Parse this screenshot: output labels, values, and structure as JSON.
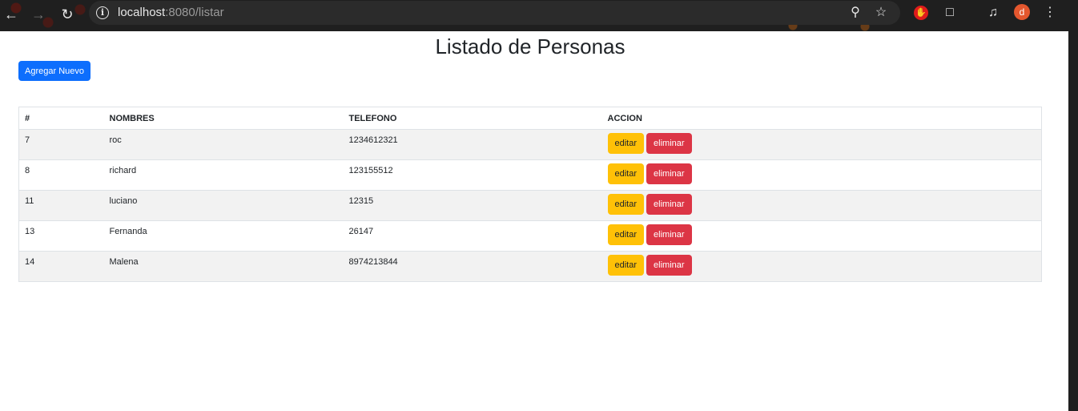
{
  "browser": {
    "url_host": "localhost",
    "url_rest": ":8080/listar",
    "avatar_letter": "d"
  },
  "page": {
    "title": "Listado de Personas",
    "add_button": "Agregar Nuevo"
  },
  "table": {
    "headers": [
      "#",
      "NOMBRES",
      "TELEFONO",
      "ACCION"
    ],
    "rows": [
      {
        "id": "7",
        "name": "roc",
        "phone": "1234612321"
      },
      {
        "id": "8",
        "name": "richard",
        "phone": "123155512"
      },
      {
        "id": "11",
        "name": "luciano",
        "phone": "12315"
      },
      {
        "id": "13",
        "name": "Fernanda",
        "phone": "26147"
      },
      {
        "id": "14",
        "name": "Malena",
        "phone": "8974213844"
      }
    ],
    "edit_label": "editar",
    "delete_label": "eliminar"
  },
  "colors": {
    "primary": "#0d6efd",
    "warning": "#ffc107",
    "danger": "#dc3545"
  }
}
